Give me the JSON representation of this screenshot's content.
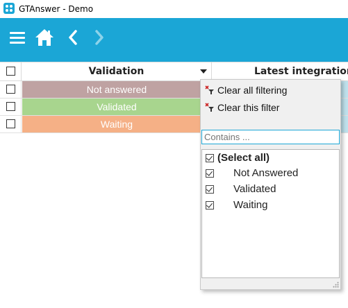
{
  "window": {
    "title": "GTAnswer - Demo",
    "icon": "gtanswer-app-icon"
  },
  "toolbar": {
    "accent_color": "#1ba6d6",
    "icons": [
      "hamburger-menu-icon",
      "home-icon",
      "back-arrow-icon",
      "forward-arrow-icon"
    ]
  },
  "grid": {
    "columns": {
      "validation": "Validation",
      "latest": "Latest integration"
    },
    "rows": [
      {
        "validation": "Not answered",
        "color": "#bfa2a2"
      },
      {
        "validation": "Validated",
        "color": "#a8d58e"
      },
      {
        "validation": "Waiting",
        "color": "#f5b086"
      }
    ]
  },
  "filter_popup": {
    "clear_all": "Clear all filtering",
    "clear_this": "Clear this filter",
    "search_placeholder": "Contains ...",
    "select_all": "(Select all)",
    "options": [
      "Not Answered",
      "Validated",
      "Waiting"
    ]
  }
}
